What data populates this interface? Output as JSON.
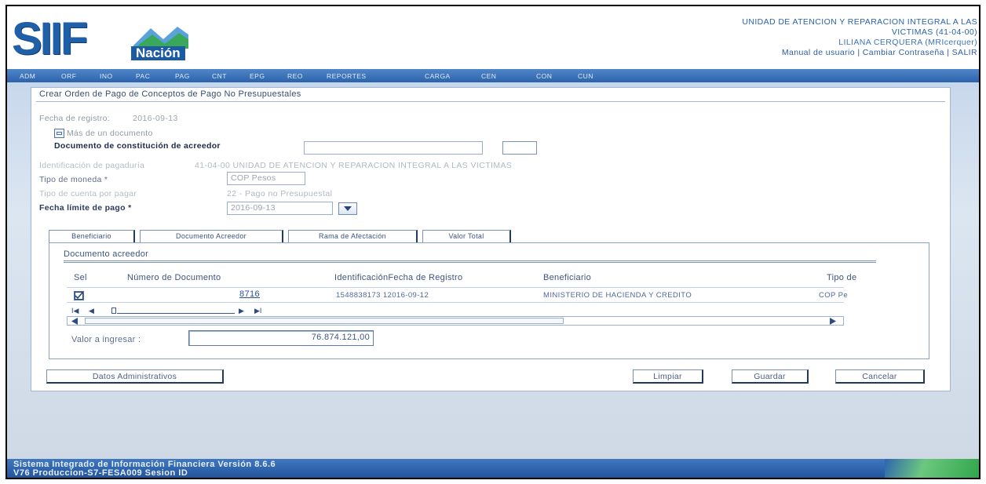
{
  "header": {
    "logo_text": "SIIF",
    "logo_sub": "Nación",
    "entity_line1": "UNIDAD DE ATENCION Y REPARACION INTEGRAL A LAS",
    "entity_line2": "VICTIMAS (41-04-00)",
    "user": "LILIANA CERQUERA (MRIcerquer)",
    "link_manual": "Manual de usuario",
    "link_sep1": " | ",
    "link_password": "Cambiar Contraseña",
    "link_sep2": " | ",
    "link_exit": "SALIR"
  },
  "menu": [
    "ADM",
    "ORF",
    "INO",
    "PAC",
    "PAG",
    "CNT",
    "EPG",
    "REO",
    "REPORTES",
    "CARGA",
    "CEN",
    "CON",
    "CUN"
  ],
  "form": {
    "title": "Crear Orden de Pago de Conceptos de Pago No Presupuestales",
    "fecha_registro_label": "Fecha de registro:",
    "fecha_registro_value": "2016-09-13",
    "mas_documento_label": "Más de un documento",
    "doc_constitucion_label": "Documento de constitución de acreedor",
    "doc_constitucion_value": "",
    "identificacion_pagaduria_label": "Identificación de pagaduría",
    "identificacion_pagaduria_value": "41-04-00 UNIDAD DE ATENCION Y REPARACION INTEGRAL A LAS VICTIMAS",
    "tipo_moneda_label": "Tipo de moneda *",
    "tipo_moneda_value": "COP Pesos",
    "tipo_cuenta_label": "Tipo de cuenta por pagar",
    "tipo_cuenta_value": "22 - Pago no Presupuestal",
    "fecha_limite_label": "Fecha límite de pago *",
    "fecha_limite_value": "2016-09-13"
  },
  "tabs": [
    "Beneficiario",
    "Documento Acreedor",
    "Rama de Afectación",
    "Valor Total"
  ],
  "tab_content": {
    "section_title": "Documento acreedor",
    "columns": [
      "Sel",
      "Número de Documento",
      "IdentificaciónFecha de Registro",
      "Beneficiario",
      "Tipo de"
    ],
    "rows": [
      {
        "numero": "8716",
        "identificacion_fecha": "1548838173 12016-09-12",
        "beneficiario": "MINISTERIO DE HACIENDA Y CREDITO",
        "tipo": "COP Pe"
      }
    ],
    "pager": {
      "first": "I◀",
      "prev": "◀",
      "next": "▶",
      "last": "▶I"
    },
    "valor_label": "Valor a ingresar :",
    "valor_value": "76.874.121,00"
  },
  "buttons": {
    "datos_admin": "Datos Administrativos",
    "limpiar": "Limpiar",
    "guardar": "Guardar",
    "cancelar": "Cancelar"
  },
  "footer": {
    "line1": "Sistema Integrado de Información Financiera Versión 8.6.6",
    "line2": "V76 Produccion-S7-FESA009 Sesion ID"
  }
}
